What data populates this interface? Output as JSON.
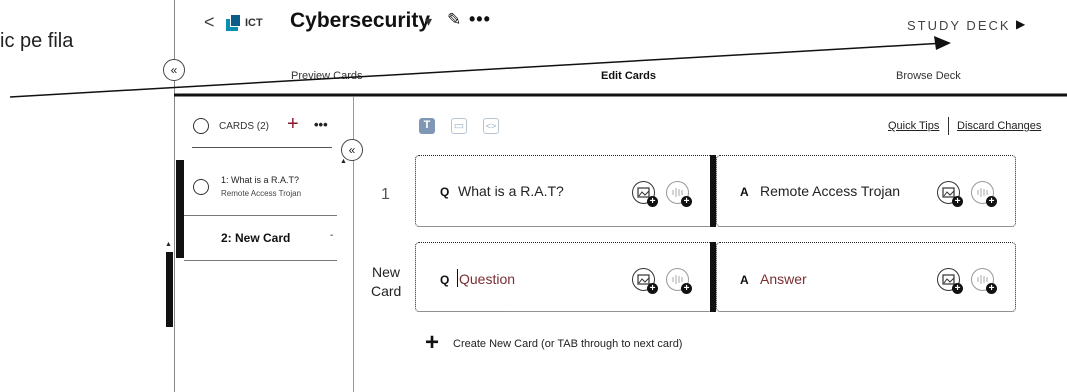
{
  "clipped_text": "ic pe fila",
  "header": {
    "back": "<",
    "deck_code": "ICT",
    "deck_title": "Cybersecurity",
    "title_caret": "▾",
    "edit_icon": "pencil-icon",
    "more": "•••",
    "study_label": "STUDY DECK",
    "study_icon": "▶"
  },
  "tabs": [
    {
      "label": "Preview Cards"
    },
    {
      "label": "Edit Cards"
    },
    {
      "label": "Browse Deck"
    }
  ],
  "sidebar": {
    "cards_label": "CARDS (2)",
    "add": "+",
    "more": "•••",
    "items": [
      {
        "title": "1: What is a R.A.T?",
        "subtitle": "Remote Access Trojan"
      },
      {
        "title": "2: New Card"
      }
    ]
  },
  "editor": {
    "tool_text": "T",
    "tool_layout": "▭",
    "tool_code": "<>",
    "quick_tips": "Quick Tips",
    "discard": "Discard Changes",
    "rows": [
      {
        "num": "1",
        "q_label": "Q",
        "q_text": "What is a R.A.T?",
        "a_label": "A",
        "a_text": "Remote Access Trojan"
      },
      {
        "num_line1": "New",
        "num_line2": "Card",
        "q_label": "Q",
        "q_placeholder": "Question",
        "a_label": "A",
        "a_placeholder": "Answer"
      }
    ],
    "create_plus": "+",
    "create_label": "Create New Card (or TAB through to next card)"
  },
  "colors": {
    "accent_red": "#8b1a2b",
    "placeholder": "#7a2f33",
    "logo_blue": "#0a8fb0"
  }
}
